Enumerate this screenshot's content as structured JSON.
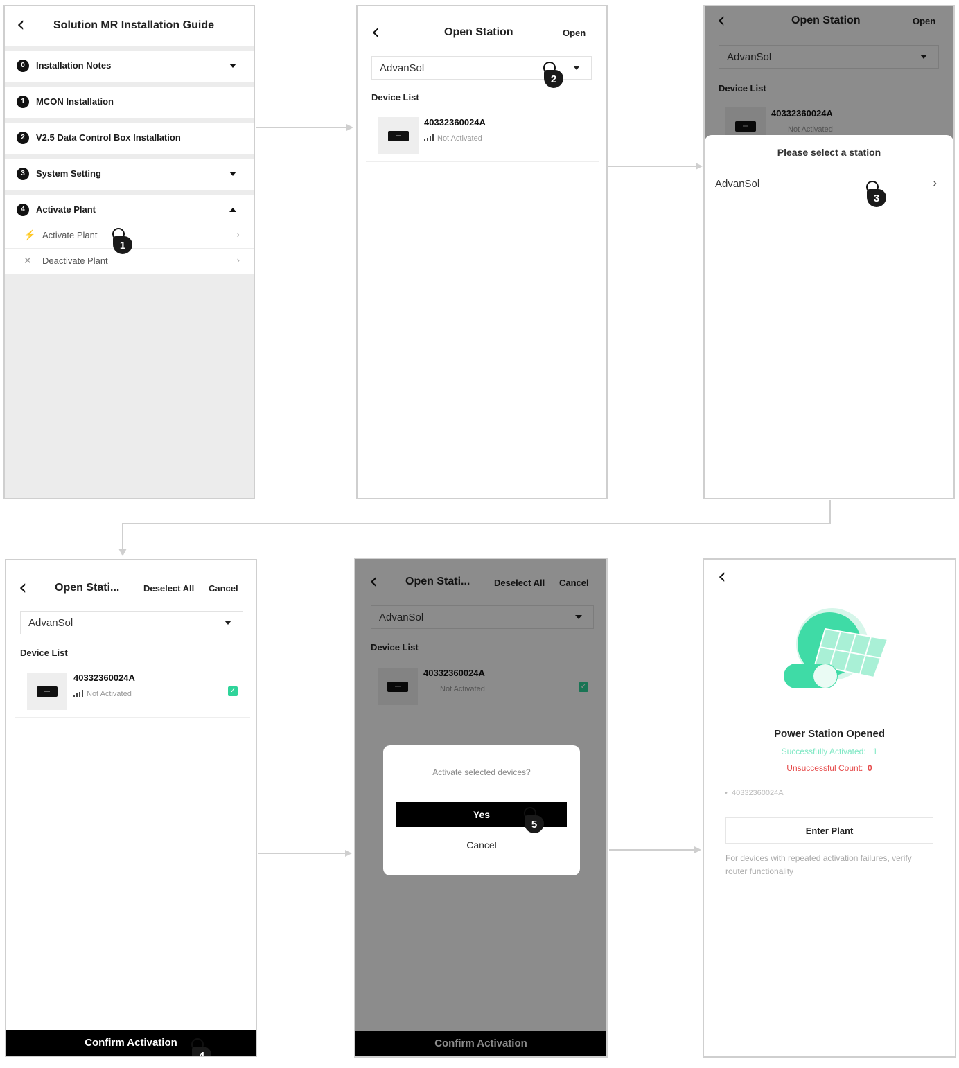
{
  "guide": {
    "title": "Solution MR Installation Guide",
    "sections": [
      {
        "num": "0",
        "label": "Installation Notes",
        "expand": "down"
      },
      {
        "num": "1",
        "label": "MCON Installation",
        "expand": "none"
      },
      {
        "num": "2",
        "label": "V2.5  Data Control Box Installation",
        "expand": "none"
      },
      {
        "num": "3",
        "label": "System Setting",
        "expand": "down"
      },
      {
        "num": "4",
        "label": "Activate Plant",
        "expand": "up"
      }
    ],
    "sub_items": [
      {
        "label": "Activate Plant",
        "icon": "lightning-icon"
      },
      {
        "label": "Deactivate Plant",
        "icon": "lightning-off-icon"
      }
    ]
  },
  "station": {
    "title": "Open Station",
    "title_short": "Open Stati...",
    "open_label": "Open",
    "deselect_label": "Deselect All",
    "cancel_label": "Cancel",
    "selected_station": "AdvanSol",
    "device_list_label": "Device List",
    "device_sn": "40332360024A",
    "device_status": "Not Activated"
  },
  "picker": {
    "title": "Please select a station",
    "item": "AdvanSol"
  },
  "confirm_button": "Confirm Activation",
  "dialog": {
    "message": "Activate selected devices?",
    "yes": "Yes",
    "cancel": "Cancel"
  },
  "result": {
    "title": "Power Station Opened",
    "success_label": "Successfully Activated:",
    "success_count": "1",
    "fail_label": "Unsuccessful Count:",
    "fail_count": "0",
    "device_sn": "40332360024A",
    "enter_button": "Enter Plant",
    "note": "For devices with repeated activation failures, verify router functionality"
  },
  "steps": [
    "1",
    "2",
    "3",
    "4",
    "5"
  ],
  "colors": {
    "accent_green": "#2fd49a",
    "error_red": "#e64b4b",
    "primary_black": "#000000"
  }
}
